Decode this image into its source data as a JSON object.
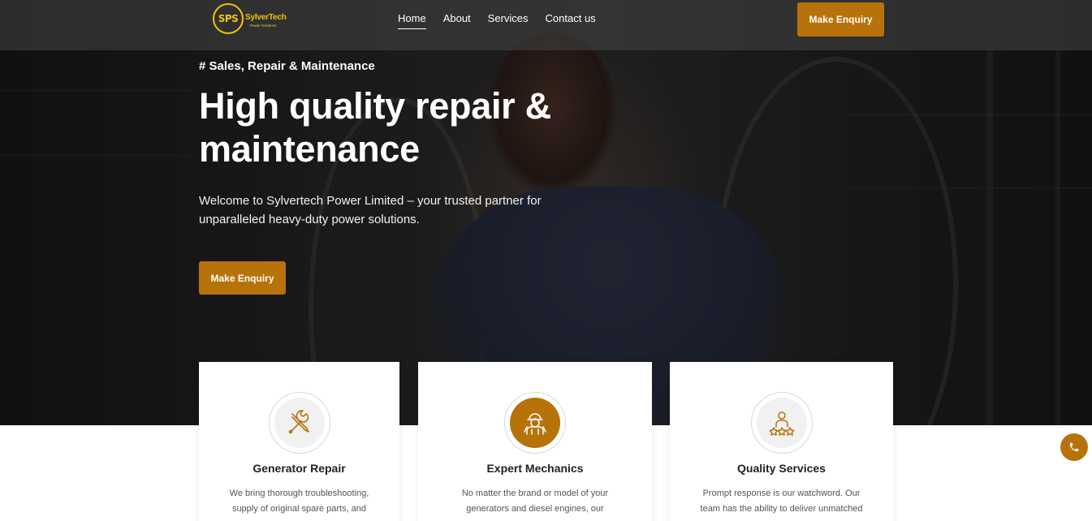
{
  "brand": {
    "logo_mark": "SPS",
    "name": "SylverTech",
    "tagline": "Power Solutions",
    "accent_color": "#b7730a",
    "logo_color": "#f1c40f"
  },
  "nav": {
    "links": [
      {
        "label": "Home",
        "active": true
      },
      {
        "label": "About",
        "active": false
      },
      {
        "label": "Services",
        "active": false
      },
      {
        "label": "Contact us",
        "active": false
      }
    ],
    "cta_label": "Make Enquiry"
  },
  "hero": {
    "eyebrow": "# Sales, Repair & Maintenance",
    "headline": "High quality repair & maintenance",
    "intro": "Welcome to Sylvertech Power Limited – your trusted partner for unparalleled heavy-duty power solutions.",
    "cta_label": "Make Enquiry"
  },
  "cards": [
    {
      "icon": "tools-icon",
      "title": "Generator Repair",
      "text": "We bring thorough troubleshooting, supply of original spare parts, and"
    },
    {
      "icon": "mechanic-icon",
      "title": "Expert Mechanics",
      "text": "No matter the brand or model of your generators and diesel engines, our"
    },
    {
      "icon": "quality-service-icon",
      "title": "Quality Services",
      "text": "Prompt response is our watchword. Our team has the ability to deliver unmatched"
    }
  ],
  "floating": {
    "icon": "phone-icon"
  }
}
